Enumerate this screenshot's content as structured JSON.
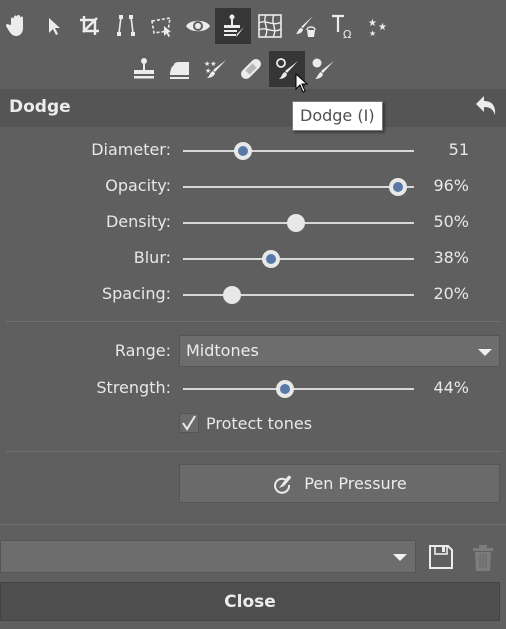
{
  "toolbar": {
    "row1": [
      {
        "name": "hand-tool",
        "icon": "hand-icon",
        "active": false
      },
      {
        "name": "select-tool",
        "icon": "arrow-pointer-icon",
        "active": false
      },
      {
        "name": "crop-tool",
        "icon": "crop-icon",
        "active": false
      },
      {
        "name": "straighten-tool",
        "icon": "perspective-lines-icon",
        "active": false
      },
      {
        "name": "selection-tool",
        "icon": "lasso-select-icon",
        "active": false
      },
      {
        "name": "red-eye-tool",
        "icon": "eye-icon",
        "active": false
      },
      {
        "name": "retouch-tools",
        "icon": "stamp-brush-icon",
        "active": true
      },
      {
        "name": "warp-tool",
        "icon": "mesh-warp-icon",
        "active": false
      },
      {
        "name": "paint-tool",
        "icon": "brush-bucket-icon",
        "active": false
      },
      {
        "name": "text-tool",
        "icon": "text-symbol-icon",
        "active": false
      },
      {
        "name": "effects-tool",
        "icon": "stars-icon",
        "active": false
      }
    ],
    "row2": [
      {
        "name": "clone-stamp-tool",
        "icon": "stamp-icon",
        "active": false
      },
      {
        "name": "smudge-iron-tool",
        "icon": "iron-icon",
        "active": false
      },
      {
        "name": "magic-brush-tool",
        "icon": "sparkle-brush-icon",
        "active": false
      },
      {
        "name": "healing-tool",
        "icon": "bandage-icon",
        "active": false
      },
      {
        "name": "dodge-tool",
        "icon": "dodge-brush-icon",
        "active": true
      },
      {
        "name": "burn-tool",
        "icon": "burn-brush-icon",
        "active": false
      }
    ]
  },
  "tooltip": "Dodge (I)",
  "panel": {
    "title": "Dodge",
    "undo_icon": "undo-icon"
  },
  "sliders": [
    {
      "key": "diameter",
      "label": "Diameter:",
      "value": "51",
      "fraction": 0.26,
      "style": "blue"
    },
    {
      "key": "opacity",
      "label": "Opacity:",
      "value": "96%",
      "fraction": 0.93,
      "style": "blue"
    },
    {
      "key": "density",
      "label": "Density:",
      "value": "50%",
      "fraction": 0.49,
      "style": "plain"
    },
    {
      "key": "blur",
      "label": "Blur:",
      "value": "38%",
      "fraction": 0.38,
      "style": "blue"
    },
    {
      "key": "spacing",
      "label": "Spacing:",
      "value": "20%",
      "fraction": 0.21,
      "style": "plain"
    }
  ],
  "range": {
    "label": "Range:",
    "selected": "Midtones"
  },
  "strength": {
    "label": "Strength:",
    "value": "44%",
    "fraction": 0.44,
    "style": "blue"
  },
  "protect_tones": {
    "label": "Protect tones",
    "checked": true
  },
  "pen_pressure": {
    "label": "Pen Pressure",
    "icon": "pen-pressure-icon"
  },
  "preset": {
    "selected": "",
    "save_icon": "save-icon",
    "delete_icon": "trash-icon"
  },
  "close_label": "Close",
  "colors": {
    "background": "#5f5f5f",
    "header": "#555555",
    "active_tool": "#363636",
    "knob_accent": "#5878a8"
  }
}
